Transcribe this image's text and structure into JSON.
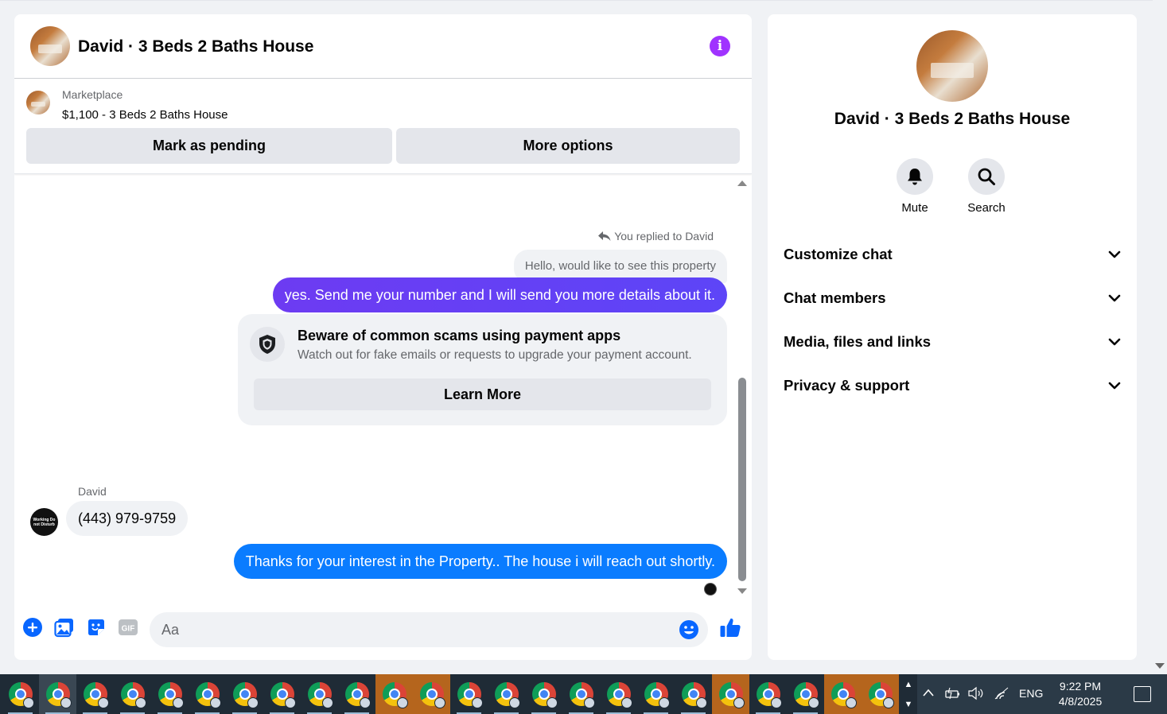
{
  "chat": {
    "title": "David · 3 Beds 2 Baths House",
    "listing": {
      "source": "Marketplace",
      "name": "$1,100 - 3 Beds 2 Baths House",
      "pending_label": "Mark as pending",
      "more_label": "More options"
    },
    "messages": {
      "replied_label": "You replied to David",
      "quoted": "Hello, would like to see this property",
      "reply": "yes. Send me your number and I will send you more details about it.",
      "scam_title": "Beware of common scams using payment apps",
      "scam_sub": "Watch out for fake emails or requests to upgrade your payment account.",
      "learn_more": "Learn More",
      "sender": "David",
      "sender_avatar_text": "Working Do not Disturb",
      "incoming": "(443) 979-9759",
      "outgoing": "Thanks for your interest in the Property.. The house i will reach  out shortly."
    },
    "composer": {
      "placeholder": "Aa"
    }
  },
  "sidebar": {
    "title": "David · 3 Beds 2 Baths House",
    "mute_label": "Mute",
    "search_label": "Search",
    "sections": [
      "Customize chat",
      "Chat members",
      "Media, files and links",
      "Privacy & support"
    ]
  },
  "taskbar": {
    "language": "ENG",
    "time": "9:22 PM",
    "date": "4/8/2025"
  },
  "colors": {
    "purple_bubble": "#6a3df7",
    "blue_bubble": "#0a7cff",
    "info_icon": "#a033ff",
    "taskbar": "#1f2b36"
  }
}
